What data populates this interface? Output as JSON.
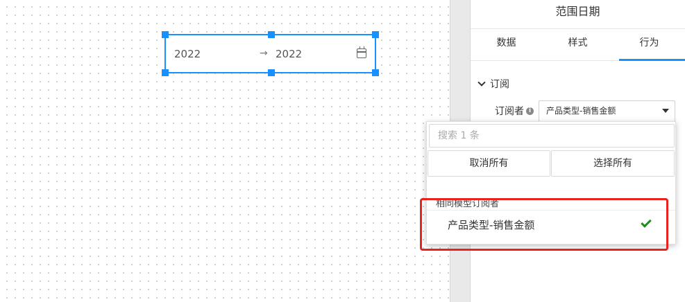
{
  "canvas": {
    "widget": {
      "start": "2022",
      "arrow": "→",
      "end": "2022",
      "icon": "calendar-icon"
    }
  },
  "panel": {
    "title": "范围日期",
    "tabs": [
      {
        "label": "数据"
      },
      {
        "label": "样式"
      },
      {
        "label": "行为"
      }
    ],
    "active_tab": "行为",
    "section": {
      "label": "订阅",
      "subscriber_label": "订阅者",
      "select_value": "产品类型-销售金额"
    }
  },
  "dropdown": {
    "search_placeholder": "搜索 1 条",
    "deselect_all": "取消所有",
    "select_all": "选择所有",
    "group_label": "相同模型订阅者",
    "items": [
      {
        "label": "产品类型-销售金额",
        "selected": true
      }
    ]
  },
  "colors": {
    "accent": "#1890ff",
    "check": "#1a8f1a",
    "annotation": "#e8231f"
  }
}
